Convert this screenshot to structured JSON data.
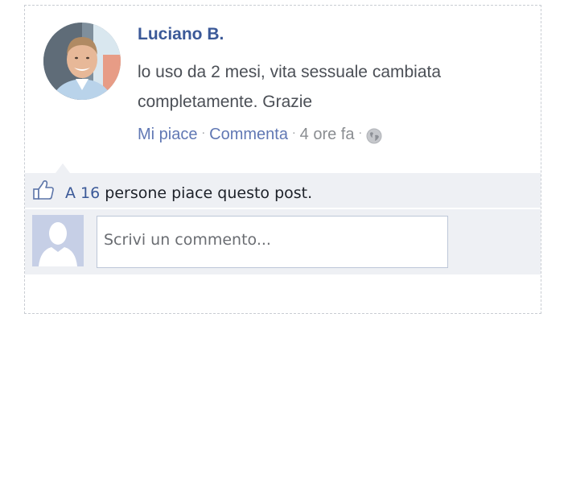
{
  "post": {
    "author": "Luciano B.",
    "comment": "lo uso da 2 mesi, vita sessuale cambiata completamente. Grazie",
    "actions": {
      "like": "Mi piace",
      "reply": "Commenta",
      "time": "4 ore fa",
      "separator": "·",
      "privacy_icon": "globe-icon"
    }
  },
  "likes": {
    "prefix": "A 16",
    "suffix": " persone piace questo post.",
    "icon": "thumbs-up-icon"
  },
  "comment_box": {
    "placeholder": "Scrivi un commento..."
  },
  "colors": {
    "link": "#3b5998",
    "action_link": "#6178b4",
    "muted": "#8a8d91",
    "panel_bg": "#eef0f4"
  }
}
